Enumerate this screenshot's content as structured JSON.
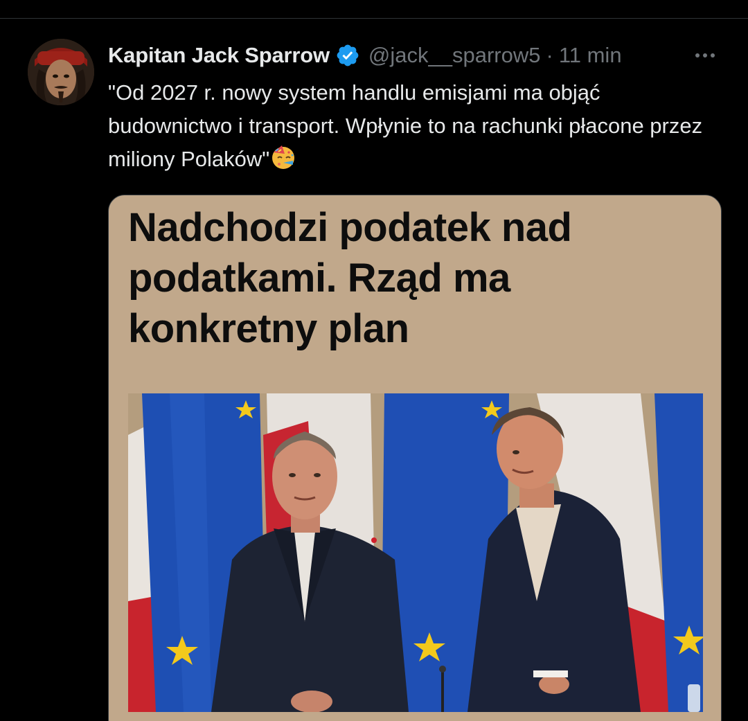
{
  "tweet": {
    "author_name": "Kapitan Jack Sparrow",
    "handle": "@jack__sparrow5",
    "separator": "·",
    "time": "11 min",
    "text": "\"Od 2027 r. nowy system handlu emisjami ma objąć budownictwo i transport. Wpłynie to na rachunki płacone przez miliony Polaków\"",
    "emoji": "face-with-party-horn"
  },
  "card": {
    "headline": "Nadchodzi podatek nad podatkami. Rząd ma konkretny plan"
  },
  "colors": {
    "background": "#000000",
    "text_primary": "#e7e9ea",
    "text_secondary": "#71767b",
    "verified_badge": "#1d9bf0",
    "card_background": "#c1a88b"
  },
  "icons": [
    "verified-badge-icon",
    "more-options-icon",
    "party-face-emoji"
  ]
}
